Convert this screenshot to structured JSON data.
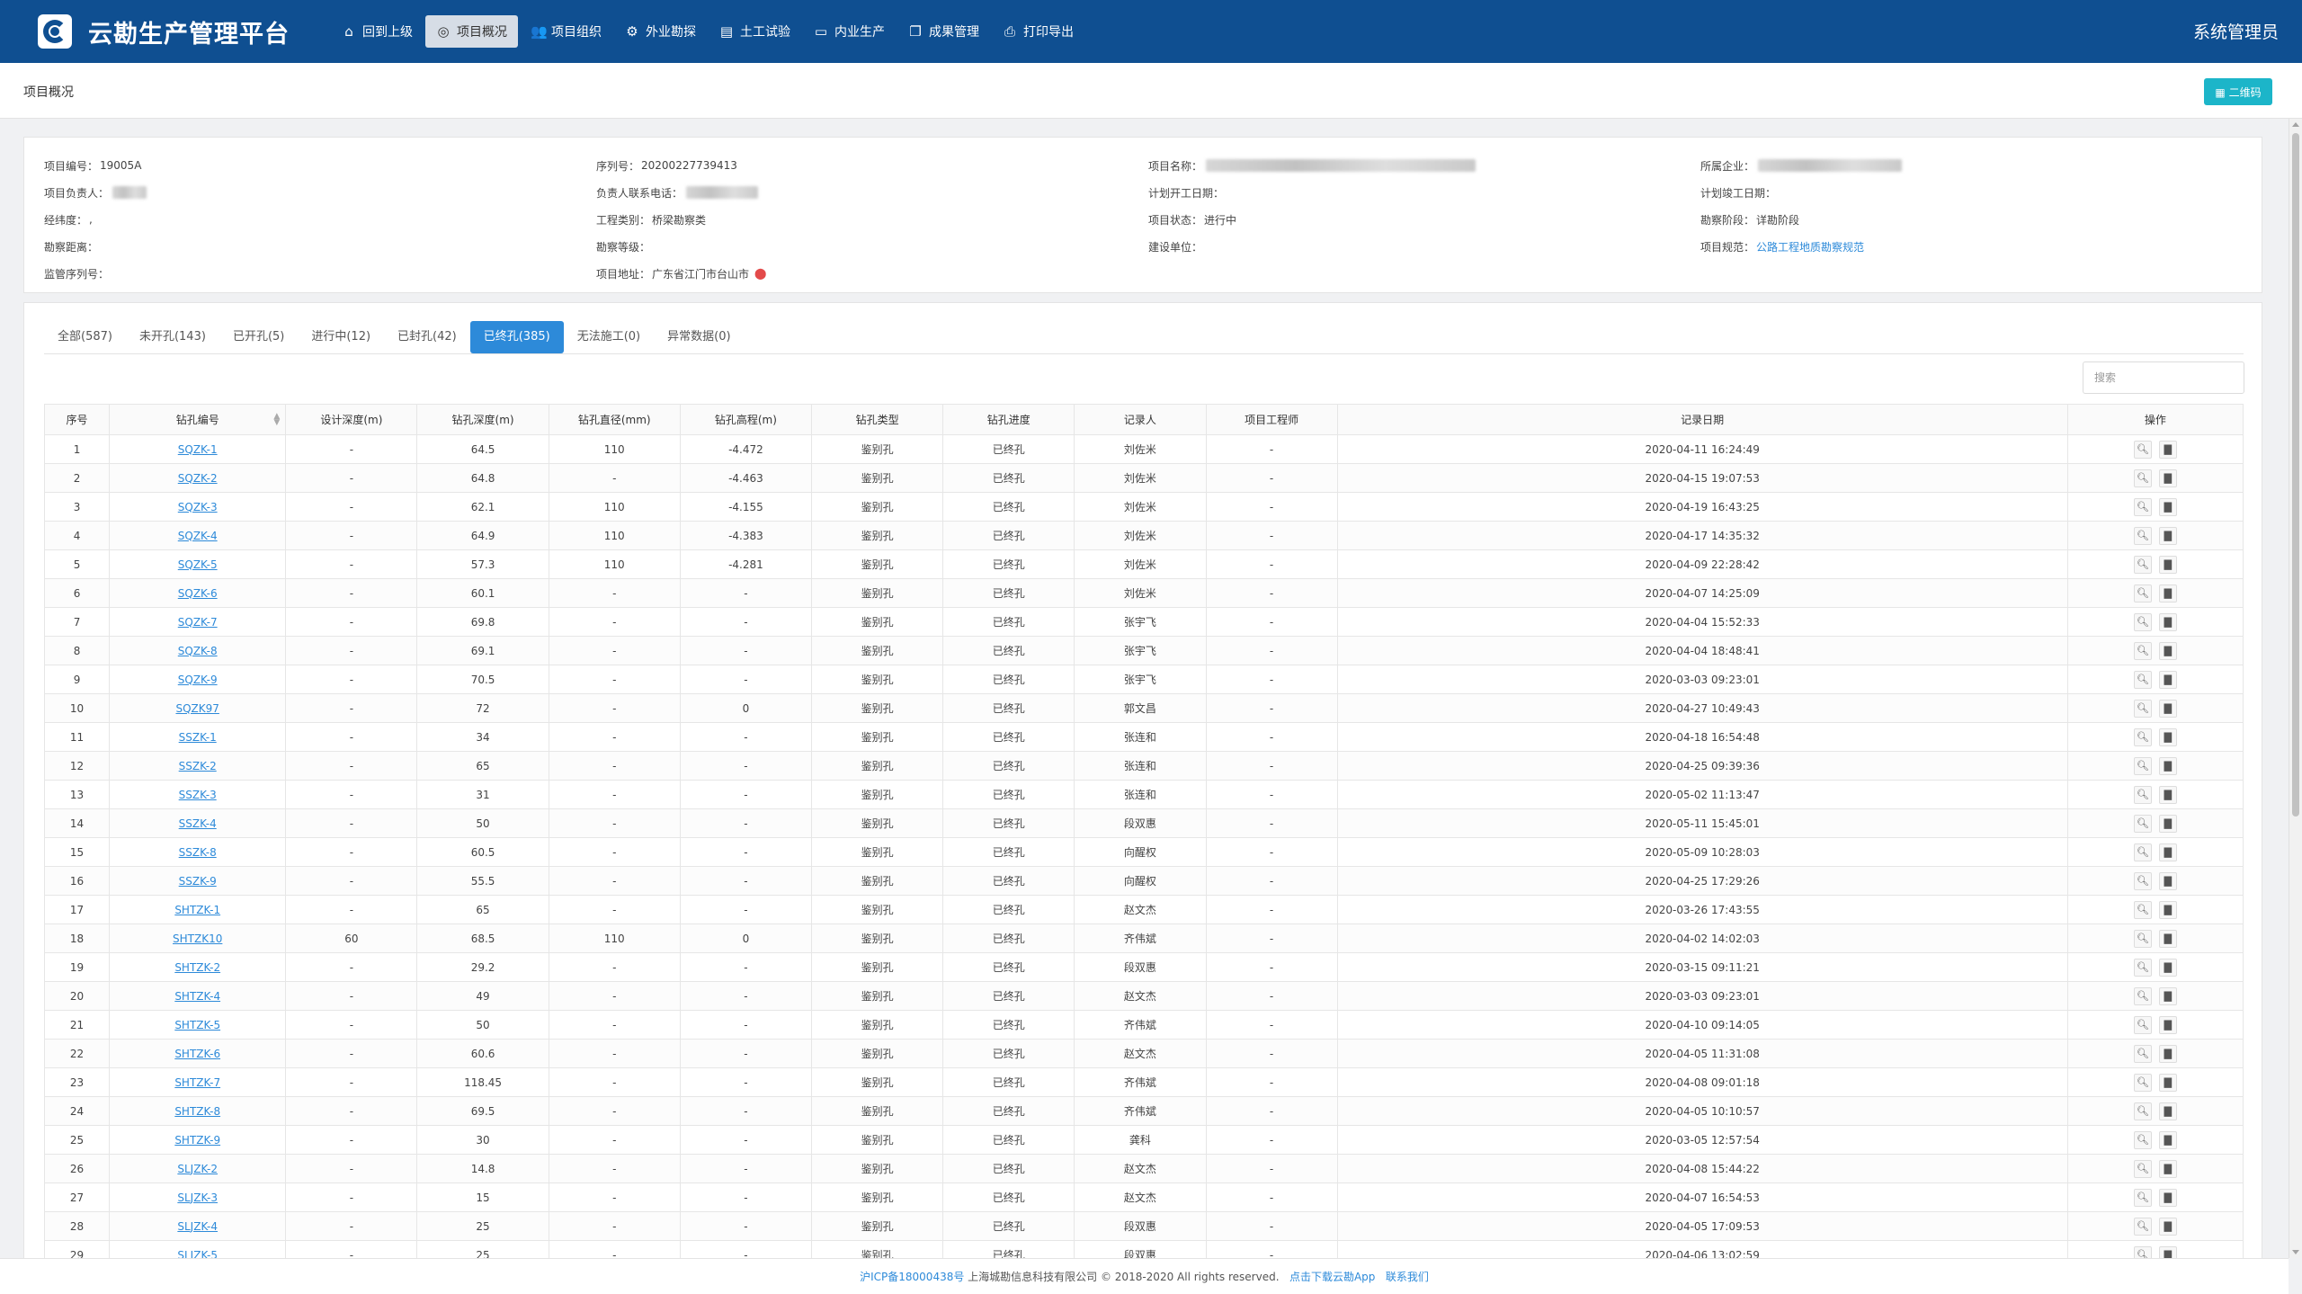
{
  "header": {
    "app_title": "云勘生产管理平台",
    "user": "系统管理员",
    "nav": [
      {
        "label": "回到上级",
        "icon": "home-icon"
      },
      {
        "label": "项目概况",
        "icon": "target-icon"
      },
      {
        "label": "项目组织",
        "icon": "users-icon"
      },
      {
        "label": "外业勘探",
        "icon": "drill-icon"
      },
      {
        "label": "土工试验",
        "icon": "document-icon"
      },
      {
        "label": "内业生产",
        "icon": "monitor-icon"
      },
      {
        "label": "成果管理",
        "icon": "files-icon"
      },
      {
        "label": "打印导出",
        "icon": "export-icon"
      }
    ]
  },
  "subbar": {
    "crumb": "项目概况",
    "qr_label": "▦ 二维码"
  },
  "info": {
    "project_no_label": "项目编号：",
    "project_no": "19005A",
    "serial_label": "序列号：",
    "serial": "20200227739413",
    "name_label": "项目名称：",
    "company_label": "所属企业：",
    "leader_label": "项目负责人：",
    "leader_phone_label": "负责人联系电话：",
    "plan_start_label": "计划开工日期：",
    "plan_end_label": "计划竣工日期：",
    "lnglat_label": "经纬度：",
    "lnglat": ",",
    "type_label": "工程类别：",
    "type": "桥梁勘察类",
    "status_label": "项目状态：",
    "status": "进行中",
    "stage_label": "勘察阶段：",
    "stage": "详勘阶段",
    "distance_label": "勘察距离：",
    "level_label": "勘察等级：",
    "builder_label": "建设单位：",
    "norm_label": "项目规范：",
    "norm": "公路工程地质勘察规范",
    "supervise_label": "监管序列号：",
    "address_label": "项目地址：",
    "address": "广东省江门市台山市"
  },
  "tabs": [
    {
      "label": "全部(587)"
    },
    {
      "label": "未开孔(143)"
    },
    {
      "label": "已开孔(5)"
    },
    {
      "label": "进行中(12)"
    },
    {
      "label": "已封孔(42)"
    },
    {
      "label": "已终孔(385)"
    },
    {
      "label": "无法施工(0)"
    },
    {
      "label": "异常数据(0)"
    }
  ],
  "search": {
    "placeholder": "搜索"
  },
  "table": {
    "columns": [
      "序号",
      "钻孔编号",
      "设计深度(m)",
      "钻孔深度(m)",
      "钻孔直径(mm)",
      "钻孔高程(m)",
      "钻孔类型",
      "钻孔进度",
      "记录人",
      "项目工程师",
      "记录日期",
      "操作"
    ],
    "rows": [
      [
        "1",
        "SQZK-1",
        "-",
        "64.5",
        "110",
        "-4.472",
        "鉴别孔",
        "已终孔",
        "刘佐米",
        "-",
        "2020-04-11 16:24:49"
      ],
      [
        "2",
        "SQZK-2",
        "-",
        "64.8",
        "-",
        "-4.463",
        "鉴别孔",
        "已终孔",
        "刘佐米",
        "-",
        "2020-04-15 19:07:53"
      ],
      [
        "3",
        "SQZK-3",
        "-",
        "62.1",
        "110",
        "-4.155",
        "鉴别孔",
        "已终孔",
        "刘佐米",
        "-",
        "2020-04-19 16:43:25"
      ],
      [
        "4",
        "SQZK-4",
        "-",
        "64.9",
        "110",
        "-4.383",
        "鉴别孔",
        "已终孔",
        "刘佐米",
        "-",
        "2020-04-17 14:35:32"
      ],
      [
        "5",
        "SQZK-5",
        "-",
        "57.3",
        "110",
        "-4.281",
        "鉴别孔",
        "已终孔",
        "刘佐米",
        "-",
        "2020-04-09 22:28:42"
      ],
      [
        "6",
        "SQZK-6",
        "-",
        "60.1",
        "-",
        "-",
        "鉴别孔",
        "已终孔",
        "刘佐米",
        "-",
        "2020-04-07 14:25:09"
      ],
      [
        "7",
        "SQZK-7",
        "-",
        "69.8",
        "-",
        "-",
        "鉴别孔",
        "已终孔",
        "张宇飞",
        "-",
        "2020-04-04 15:52:33"
      ],
      [
        "8",
        "SQZK-8",
        "-",
        "69.1",
        "-",
        "-",
        "鉴别孔",
        "已终孔",
        "张宇飞",
        "-",
        "2020-04-04 18:48:41"
      ],
      [
        "9",
        "SQZK-9",
        "-",
        "70.5",
        "-",
        "-",
        "鉴别孔",
        "已终孔",
        "张宇飞",
        "-",
        "2020-03-03 09:23:01"
      ],
      [
        "10",
        "SQZK97",
        "-",
        "72",
        "-",
        "0",
        "鉴别孔",
        "已终孔",
        "郭文昌",
        "-",
        "2020-04-27 10:49:43"
      ],
      [
        "11",
        "SSZK-1",
        "-",
        "34",
        "-",
        "-",
        "鉴别孔",
        "已终孔",
        "张连和",
        "-",
        "2020-04-18 16:54:48"
      ],
      [
        "12",
        "SSZK-2",
        "-",
        "65",
        "-",
        "-",
        "鉴别孔",
        "已终孔",
        "张连和",
        "-",
        "2020-04-25 09:39:36"
      ],
      [
        "13",
        "SSZK-3",
        "-",
        "31",
        "-",
        "-",
        "鉴别孔",
        "已终孔",
        "张连和",
        "-",
        "2020-05-02 11:13:47"
      ],
      [
        "14",
        "SSZK-4",
        "-",
        "50",
        "-",
        "-",
        "鉴别孔",
        "已终孔",
        "段双惠",
        "-",
        "2020-05-11 15:45:01"
      ],
      [
        "15",
        "SSZK-8",
        "-",
        "60.5",
        "-",
        "-",
        "鉴别孔",
        "已终孔",
        "向醒权",
        "-",
        "2020-05-09 10:28:03"
      ],
      [
        "16",
        "SSZK-9",
        "-",
        "55.5",
        "-",
        "-",
        "鉴别孔",
        "已终孔",
        "向醒权",
        "-",
        "2020-04-25 17:29:26"
      ],
      [
        "17",
        "SHTZK-1",
        "-",
        "65",
        "-",
        "-",
        "鉴别孔",
        "已终孔",
        "赵文杰",
        "-",
        "2020-03-26 17:43:55"
      ],
      [
        "18",
        "SHTZK10",
        "60",
        "68.5",
        "110",
        "0",
        "鉴别孔",
        "已终孔",
        "齐伟斌",
        "-",
        "2020-04-02 14:02:03"
      ],
      [
        "19",
        "SHTZK-2",
        "-",
        "29.2",
        "-",
        "-",
        "鉴别孔",
        "已终孔",
        "段双惠",
        "-",
        "2020-03-15 09:11:21"
      ],
      [
        "20",
        "SHTZK-4",
        "-",
        "49",
        "-",
        "-",
        "鉴别孔",
        "已终孔",
        "赵文杰",
        "-",
        "2020-03-03 09:23:01"
      ],
      [
        "21",
        "SHTZK-5",
        "-",
        "50",
        "-",
        "-",
        "鉴别孔",
        "已终孔",
        "齐伟斌",
        "-",
        "2020-04-10 09:14:05"
      ],
      [
        "22",
        "SHTZK-6",
        "-",
        "60.6",
        "-",
        "-",
        "鉴别孔",
        "已终孔",
        "赵文杰",
        "-",
        "2020-04-05 11:31:08"
      ],
      [
        "23",
        "SHTZK-7",
        "-",
        "118.45",
        "-",
        "-",
        "鉴别孔",
        "已终孔",
        "齐伟斌",
        "-",
        "2020-04-08 09:01:18"
      ],
      [
        "24",
        "SHTZK-8",
        "-",
        "69.5",
        "-",
        "-",
        "鉴别孔",
        "已终孔",
        "齐伟斌",
        "-",
        "2020-04-05 10:10:57"
      ],
      [
        "25",
        "SHTZK-9",
        "-",
        "30",
        "-",
        "-",
        "鉴别孔",
        "已终孔",
        "龚科",
        "-",
        "2020-03-05 12:57:54"
      ],
      [
        "26",
        "SLJZK-2",
        "-",
        "14.8",
        "-",
        "-",
        "鉴别孔",
        "已终孔",
        "赵文杰",
        "-",
        "2020-04-08 15:44:22"
      ],
      [
        "27",
        "SLJZK-3",
        "-",
        "15",
        "-",
        "-",
        "鉴别孔",
        "已终孔",
        "赵文杰",
        "-",
        "2020-04-07 16:54:53"
      ],
      [
        "28",
        "SLJZK-4",
        "-",
        "25",
        "-",
        "-",
        "鉴别孔",
        "已终孔",
        "段双惠",
        "-",
        "2020-04-05 17:09:53"
      ],
      [
        "29",
        "SLJZK-5",
        "-",
        "25",
        "-",
        "-",
        "鉴别孔",
        "已终孔",
        "段双惠",
        "-",
        "2020-04-06 13:02:59"
      ]
    ]
  },
  "footer": {
    "icp": "沪ICP备18000438号",
    "copyright": "上海城勘信息科技有限公司 © 2018-2020 All rights reserved.",
    "download": "点击下载云勘App",
    "contact": "联系我们"
  }
}
